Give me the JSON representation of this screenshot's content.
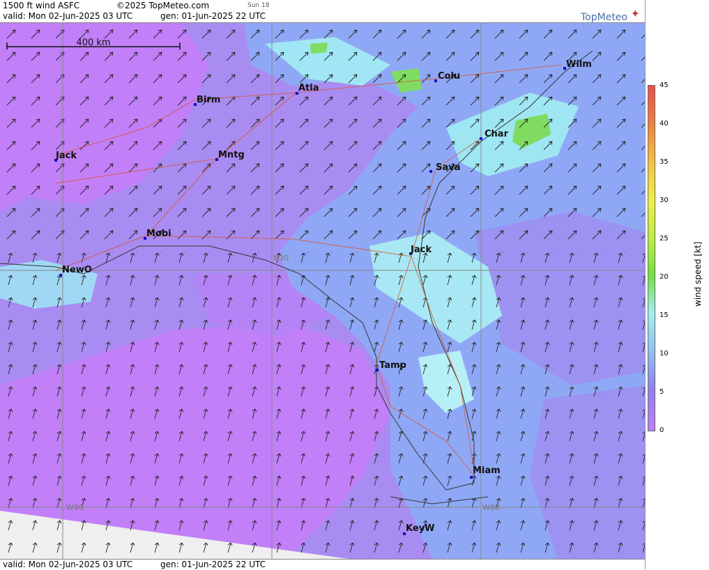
{
  "header": {
    "title": "1500 ft wind ASFC",
    "copyright": "©2025 TopMeteo.com",
    "day": "Sun 18",
    "valid": "valid:  Mon  02-Jun-2025  03 UTC",
    "gen": "gen: 01-Jun-2025 22 UTC"
  },
  "footer": {
    "valid": "valid:  Mon  02-Jun-2025  03 UTC",
    "gen": "gen: 01-Jun-2025 22 UTC"
  },
  "logo": "TopMeteo",
  "scale_label": "400 km",
  "map_labels": {
    "lat": "N30",
    "lon_w90": "W90",
    "lon_w80": "W80"
  },
  "cities": [
    {
      "name": "Birm"
    },
    {
      "name": "Atla"
    },
    {
      "name": "Colu"
    },
    {
      "name": "Wilm"
    },
    {
      "name": "Char"
    },
    {
      "name": "Jack"
    },
    {
      "name": "Mntg"
    },
    {
      "name": "Sava"
    },
    {
      "name": "Mobi"
    },
    {
      "name": "Jack"
    },
    {
      "name": "NewO"
    },
    {
      "name": "Tamp"
    },
    {
      "name": "Miam"
    },
    {
      "name": "KeyW"
    }
  ],
  "colorbar": {
    "title": "wind speed  [kt]",
    "ticks": [
      "45",
      "40",
      "35",
      "30",
      "25",
      "20",
      "15",
      "10",
      "5",
      "0"
    ],
    "colors": [
      "#e8504a",
      "#f08040",
      "#f4c040",
      "#f0f040",
      "#c0f040",
      "#70e040",
      "#a0f0f0",
      "#90c0f0",
      "#9080f0",
      "#c080f8"
    ]
  }
}
